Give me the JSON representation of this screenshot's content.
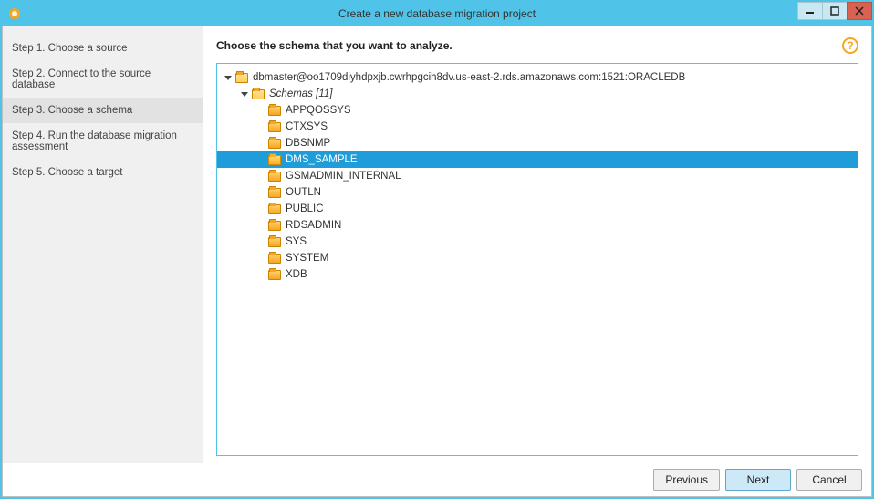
{
  "window": {
    "title": "Create a new database migration project"
  },
  "sidebar": {
    "steps": [
      {
        "label": "Step 1. Choose a source",
        "active": false
      },
      {
        "label": "Step 2. Connect to the source database",
        "active": false
      },
      {
        "label": "Step 3. Choose a schema",
        "active": true
      },
      {
        "label": "Step 4. Run the database migration assessment",
        "active": false
      },
      {
        "label": "Step 5. Choose a target",
        "active": false
      }
    ]
  },
  "main": {
    "heading": "Choose the schema that you want to analyze.",
    "tree": {
      "root": "dbmaster@oo1709diyhdpxjb.cwrhpgcih8dv.us-east-2.rds.amazonaws.com:1521:ORACLEDB",
      "schemas_label": "Schemas [11]",
      "items": [
        {
          "name": "APPQOSSYS",
          "selected": false
        },
        {
          "name": "CTXSYS",
          "selected": false
        },
        {
          "name": "DBSNMP",
          "selected": false
        },
        {
          "name": "DMS_SAMPLE",
          "selected": true
        },
        {
          "name": "GSMADMIN_INTERNAL",
          "selected": false
        },
        {
          "name": "OUTLN",
          "selected": false
        },
        {
          "name": "PUBLIC",
          "selected": false
        },
        {
          "name": "RDSADMIN",
          "selected": false
        },
        {
          "name": "SYS",
          "selected": false
        },
        {
          "name": "SYSTEM",
          "selected": false
        },
        {
          "name": "XDB",
          "selected": false
        }
      ]
    }
  },
  "footer": {
    "previous": "Previous",
    "next": "Next",
    "cancel": "Cancel"
  }
}
